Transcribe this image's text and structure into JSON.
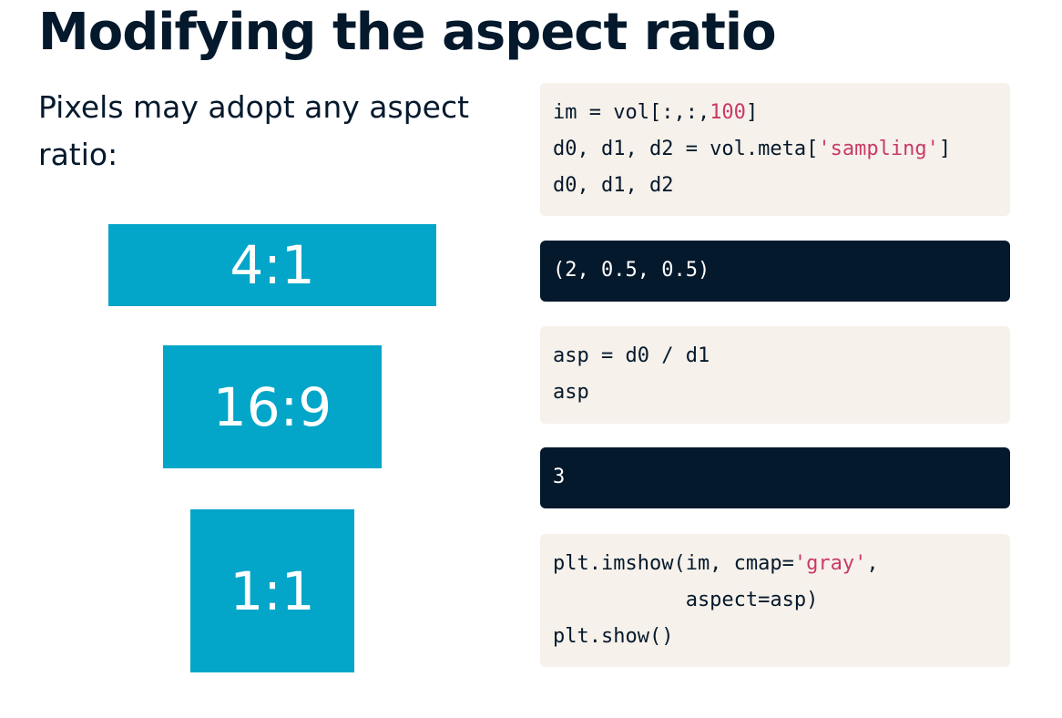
{
  "title": "Modifying the aspect ratio",
  "intro": "Pixels may adopt any aspect ratio:",
  "ratios": [
    "4:1",
    "16:9",
    "1:1"
  ],
  "colors": {
    "accent": "#03a6c8",
    "text": "#05192d",
    "code_input_bg": "#f6f1ea",
    "code_output_bg": "#05192d",
    "code_literal": "#c93a67"
  },
  "code_blocks": {
    "block1": {
      "l1_a": "im = vol[:,:,",
      "l1_num": "100",
      "l1_b": "]",
      "l2_a": "d0, d1, d2 = vol.meta[",
      "l2_str": "'sampling'",
      "l2_b": "]",
      "l3": "d0, d1, d2"
    },
    "output1": "(2, 0.5, 0.5)",
    "block2": {
      "l1": "asp = d0 / d1",
      "l2": "asp"
    },
    "output2": "3",
    "block3": {
      "l1_a": "plt.imshow(im, cmap=",
      "l1_str": "'gray'",
      "l1_b": ",",
      "l2": "           aspect=asp)",
      "l3": "plt.show()"
    }
  }
}
